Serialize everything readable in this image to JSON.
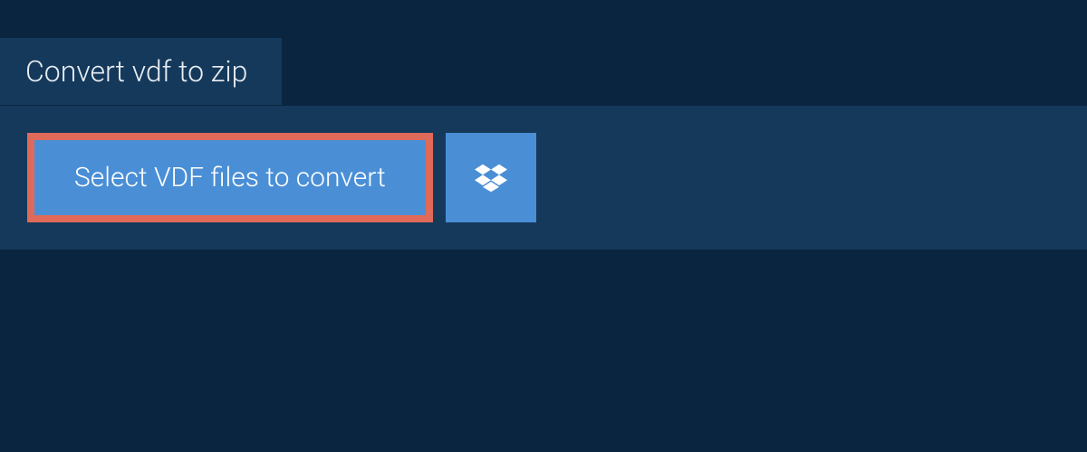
{
  "tab": {
    "title": "Convert vdf to zip"
  },
  "actions": {
    "select_label": "Select VDF files to convert",
    "dropbox_icon": "dropbox"
  },
  "colors": {
    "background": "#0a2540",
    "panel": "#15395b",
    "button": "#4a8fd6",
    "highlight_border": "#e06a5a",
    "text": "#ffffff"
  }
}
